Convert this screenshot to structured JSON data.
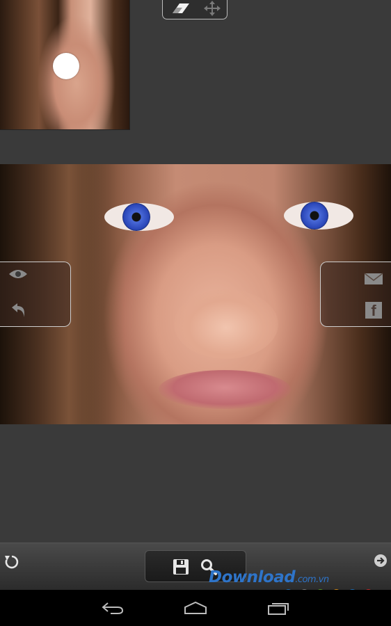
{
  "toolbar": {
    "eraser_tool": "eraser-icon",
    "move_tool": "move-icon"
  },
  "left_panel": {
    "preview": "eye-icon",
    "undo": "undo-icon"
  },
  "right_panel": {
    "email": "email-icon",
    "facebook": "f"
  },
  "bottom_bar": {
    "reset": "reset-icon",
    "save": "save-icon",
    "zoom": "zoom-icon",
    "next": "arrow-right-icon"
  },
  "watermark": {
    "text": "Download",
    "suffix": ".com.vn",
    "dot_colors": [
      "#1f6fb5",
      "#7a7a7a",
      "#5a9a2a",
      "#d08a1a",
      "#1f6fb5",
      "#c52a2a"
    ]
  },
  "nav": {
    "back": "back-icon",
    "home": "home-icon",
    "recents": "recents-icon"
  },
  "colors": {
    "background": "#3a3a3a",
    "panel_border": "#cfcfcf",
    "watermark": "#2e74c9"
  }
}
